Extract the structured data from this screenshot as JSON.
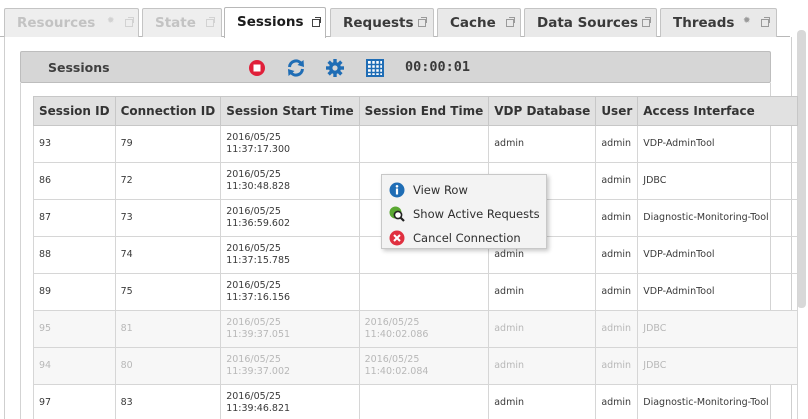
{
  "tabs": [
    {
      "label": "Resources",
      "state": "disabled",
      "icons": [
        "gear-icon",
        "popout-icon"
      ]
    },
    {
      "label": "State",
      "state": "disabled",
      "icons": [
        "popout-icon"
      ]
    },
    {
      "label": "Sessions",
      "state": "active",
      "icons": [
        "popout-icon"
      ]
    },
    {
      "label": "Requests",
      "state": "normal",
      "icons": [
        "popout-icon"
      ]
    },
    {
      "label": "Cache",
      "state": "normal",
      "icons": [
        "popout-icon"
      ]
    },
    {
      "label": "Data Sources",
      "state": "normal",
      "icons": [
        "popout-icon"
      ]
    },
    {
      "label": "Threads",
      "state": "normal",
      "icons": [
        "gear-icon",
        "popout-icon"
      ]
    }
  ],
  "toolbar": {
    "title": "Sessions",
    "timer": "00:00:01",
    "buttons": [
      "stop-icon",
      "refresh-icon",
      "settings-icon",
      "grid-icon"
    ],
    "colors": {
      "stop": "#e0203a",
      "accent": "#1f6db5"
    }
  },
  "table": {
    "columns": [
      "Session ID",
      "Connection ID",
      "Session Start Time",
      "Session End Time",
      "VDP Database",
      "User",
      "Access Interface"
    ],
    "rows": [
      {
        "id": "93",
        "conn": "79",
        "start": [
          "2016/05/25",
          "11:37:17.300"
        ],
        "end": [
          "",
          ""
        ],
        "db": "admin",
        "user": "admin",
        "iface": "VDP-AdminTool",
        "dim": false
      },
      {
        "id": "86",
        "conn": "72",
        "start": [
          "2016/05/25",
          "11:30:48.828"
        ],
        "end": [
          "",
          ""
        ],
        "db": "",
        "user": "admin",
        "iface": "JDBC",
        "dim": false
      },
      {
        "id": "87",
        "conn": "73",
        "start": [
          "2016/05/25",
          "11:36:59.602"
        ],
        "end": [
          "",
          ""
        ],
        "db": "",
        "user": "admin",
        "iface": "Diagnostic-Monitoring-Tool",
        "dim": false
      },
      {
        "id": "88",
        "conn": "74",
        "start": [
          "2016/05/25",
          "11:37:15.785"
        ],
        "end": [
          "",
          ""
        ],
        "db": "admin",
        "user": "admin",
        "iface": "VDP-AdminTool",
        "dim": false
      },
      {
        "id": "89",
        "conn": "75",
        "start": [
          "2016/05/25",
          "11:37:16.156"
        ],
        "end": [
          "",
          ""
        ],
        "db": "admin",
        "user": "admin",
        "iface": "VDP-AdminTool",
        "dim": false
      },
      {
        "id": "95",
        "conn": "81",
        "start": [
          "2016/05/25",
          "11:39:37.051"
        ],
        "end": [
          "2016/05/25",
          "11:40:02.086"
        ],
        "db": "admin",
        "user": "admin",
        "iface": "JDBC",
        "dim": true
      },
      {
        "id": "94",
        "conn": "80",
        "start": [
          "2016/05/25",
          "11:39:37.002"
        ],
        "end": [
          "2016/05/25",
          "11:40:02.084"
        ],
        "db": "admin",
        "user": "admin",
        "iface": "JDBC",
        "dim": true
      },
      {
        "id": "97",
        "conn": "83",
        "start": [
          "2016/05/25",
          "11:39:46.821"
        ],
        "end": [
          "",
          ""
        ],
        "db": "admin",
        "user": "admin",
        "iface": "Diagnostic-Monitoring-Tool",
        "dim": false
      }
    ]
  },
  "context_menu": {
    "items": [
      {
        "label": "View Row",
        "icon": "info-icon",
        "color": "#1f6db5"
      },
      {
        "label": "Show Active Requests",
        "icon": "search-requests-icon",
        "color": "#5aa832"
      },
      {
        "label": "Cancel Connection",
        "icon": "cancel-icon",
        "color": "#e03040"
      }
    ]
  }
}
